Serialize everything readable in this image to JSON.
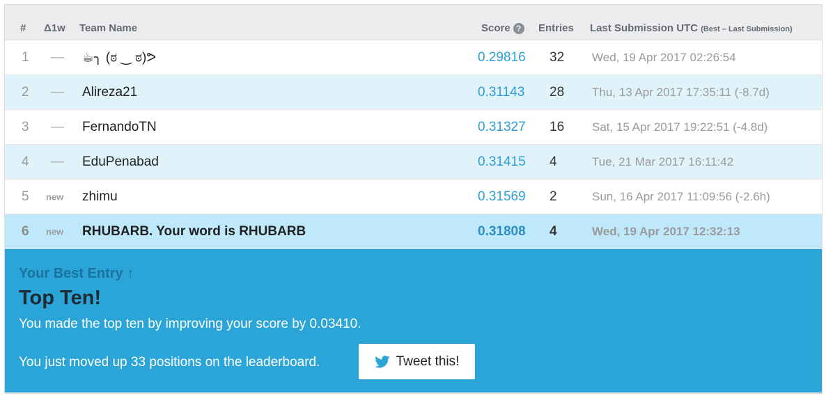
{
  "header": {
    "rank": "#",
    "delta": "Δ1w",
    "team": "Team Name",
    "score": "Score",
    "score_help_icon": "question-circle-icon",
    "entries": "Entries",
    "last": "Last Submission UTC",
    "last_small": "(Best – Last Submission)"
  },
  "rows": [
    {
      "rank": "1",
      "delta": "—",
      "team": "☕╮ (ಠ ‿ ಠ)ᕗ",
      "score": "0.29816",
      "entries": "32",
      "last": "Wed, 19 Apr 2017 02:26:54"
    },
    {
      "rank": "2",
      "delta": "—",
      "team": "Alireza21",
      "score": "0.31143",
      "entries": "28",
      "last": "Thu, 13 Apr 2017 17:35:11 (-8.7d)"
    },
    {
      "rank": "3",
      "delta": "—",
      "team": "FernandoTN",
      "score": "0.31327",
      "entries": "16",
      "last": "Sat, 15 Apr 2017 19:22:51 (-4.8d)"
    },
    {
      "rank": "4",
      "delta": "—",
      "team": "EduPenabad",
      "score": "0.31415",
      "entries": "4",
      "last": "Tue, 21 Mar 2017 16:11:42"
    },
    {
      "rank": "5",
      "delta": "new",
      "team": "zhimu",
      "score": "0.31569",
      "entries": "2",
      "last": "Sun, 16 Apr 2017 11:09:56 (-2.6h)"
    },
    {
      "rank": "6",
      "delta": "new",
      "team": "RHUBARB. Your word is RHUBARB",
      "score": "0.31808",
      "entries": "4",
      "last": "Wed, 19 Apr 2017 12:32:13"
    }
  ],
  "banner": {
    "best_entry": "Your Best Entry",
    "best_arrow": "↑",
    "title": "Top Ten!",
    "improve_text": "You made the top ten by improving your score by 0.03410.",
    "moved_text": "You just moved up 33 positions on the leaderboard.",
    "tweet_label": "Tweet this!",
    "tweet_icon": "twitter-bird-icon"
  },
  "colors": {
    "score_link": "#2b9fd5",
    "banner_bg": "#2ba5d7",
    "row_alt": "#e0f2fa",
    "row_highlight": "#bfe9fa"
  }
}
